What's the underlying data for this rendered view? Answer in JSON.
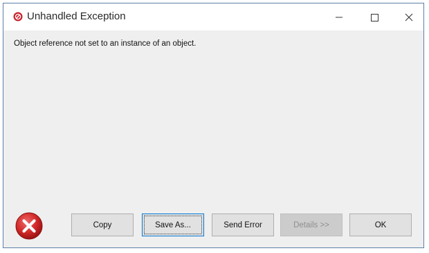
{
  "window": {
    "title": "Unhandled Exception",
    "title_icon": "error-circle-icon",
    "controls": {
      "minimize_icon": "minimize-icon",
      "maximize_icon": "maximize-icon",
      "close_icon": "close-icon"
    }
  },
  "dialog": {
    "message": "Object reference not set to an instance of an object.",
    "status_icon": "error-x-icon",
    "buttons": {
      "copy": "Copy",
      "save_as": "Save As...",
      "send_error": "Send Error",
      "details": "Details >>",
      "ok": "OK"
    },
    "details_enabled": false
  },
  "colors": {
    "error_red": "#c8202a",
    "window_bg": "#efefef",
    "focus_border": "#0078d7"
  }
}
